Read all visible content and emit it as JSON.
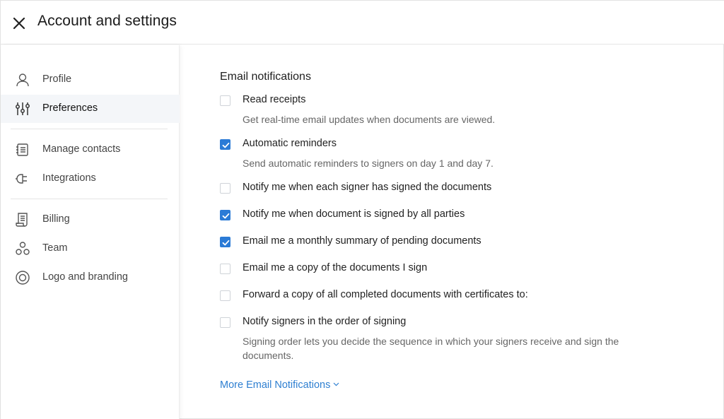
{
  "header": {
    "title": "Account and settings"
  },
  "sidebar": {
    "items": [
      {
        "label": "Profile",
        "icon": "user-icon",
        "active": false
      },
      {
        "label": "Preferences",
        "icon": "sliders-icon",
        "active": true
      },
      {
        "label": "Manage contacts",
        "icon": "contacts-book-icon",
        "active": false
      },
      {
        "label": "Integrations",
        "icon": "plug-icon",
        "active": false
      },
      {
        "label": "Billing",
        "icon": "receipt-icon",
        "active": false
      },
      {
        "label": "Team",
        "icon": "team-icon",
        "active": false
      },
      {
        "label": "Logo and branding",
        "icon": "branding-circle-icon",
        "active": false
      }
    ]
  },
  "main": {
    "section_title": "Email notifications",
    "options": [
      {
        "label": "Read receipts",
        "checked": false,
        "description": "Get real-time email updates when documents are viewed."
      },
      {
        "label": "Automatic reminders",
        "checked": true,
        "description": "Send automatic reminders to signers on day 1 and day 7."
      },
      {
        "label": "Notify me when each signer has signed the documents",
        "checked": false,
        "description": ""
      },
      {
        "label": "Notify me when document is signed by all parties",
        "checked": true,
        "description": ""
      },
      {
        "label": "Email me a monthly summary of pending documents",
        "checked": true,
        "description": ""
      },
      {
        "label": "Email me a copy of the documents I sign",
        "checked": false,
        "description": ""
      },
      {
        "label": "Forward a copy of all completed documents with certificates to:",
        "checked": false,
        "description": ""
      },
      {
        "label": "Notify signers in the order of signing",
        "checked": false,
        "description": "Signing order lets you decide the sequence in which your signers receive and sign the documents."
      }
    ],
    "more_link": "More Email Notifications"
  },
  "colors": {
    "accent": "#2b7bd6",
    "link": "#2e7fd1",
    "active_bg": "#f4f6f9"
  }
}
